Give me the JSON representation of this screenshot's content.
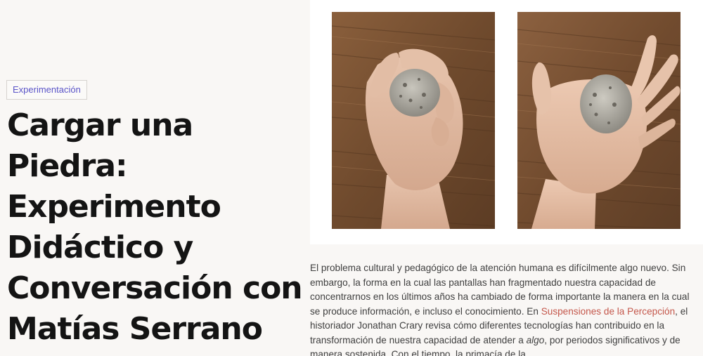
{
  "article": {
    "category": "Experimentación",
    "title_lines": [
      "Cargar una",
      "Piedra:",
      "Experimento",
      "Didáctico y",
      "Conversación con",
      "Matías Serrano"
    ]
  },
  "gallery": {
    "images": [
      {
        "description": "hand-grasping-stone"
      },
      {
        "description": "open-palm-with-stone"
      }
    ]
  },
  "body": {
    "part1": "El problema cultural y pedagógico de la atención humana es difícilmente algo nuevo. Sin embargo, la forma en la cual las pantallas han fragmentado nuestra capacidad de concentrarnos en los últimos años ha cambiado de forma importante la manera en la cual se produce información, e incluso el conocimiento. En ",
    "link": "Suspensiones de la Percepción",
    "part2": ", el historiador Jonathan Crary revisa cómo diferentes tecnologías han contribuido en la transformación de nuestra capacidad de atender a ",
    "emphasis": "algo",
    "part3": ", por periodos significativos y de manera sostenida. Con el tiempo, la primacía de la"
  },
  "colors": {
    "page_bg": "#f9f7f5",
    "accent_link": "#c4574b",
    "tag_text": "#5b55c8",
    "title": "#141414"
  }
}
